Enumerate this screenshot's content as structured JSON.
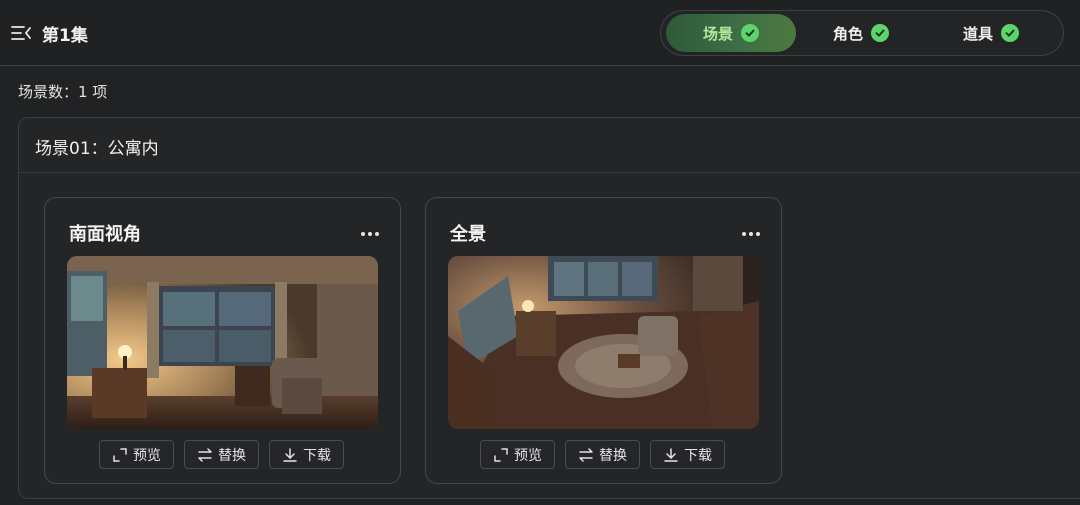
{
  "header": {
    "episode_title": "第1集",
    "tabs": [
      {
        "label": "场景",
        "active": true
      },
      {
        "label": "角色",
        "active": false
      },
      {
        "label": "道具",
        "active": false
      }
    ]
  },
  "summary": {
    "scene_count_text": "场景数：1 项"
  },
  "scene": {
    "title": "场景01：公寓内",
    "cards": [
      {
        "title": "南面视角",
        "image_alt": "南面视角场景图"
      },
      {
        "title": "全景",
        "image_alt": "全景场景图"
      }
    ]
  },
  "actions": {
    "preview": "预览",
    "replace": "替换",
    "download": "下载"
  },
  "colors": {
    "accent_green": "#5ed56a",
    "background": "#202224",
    "active_tab": "#3d6e45"
  }
}
